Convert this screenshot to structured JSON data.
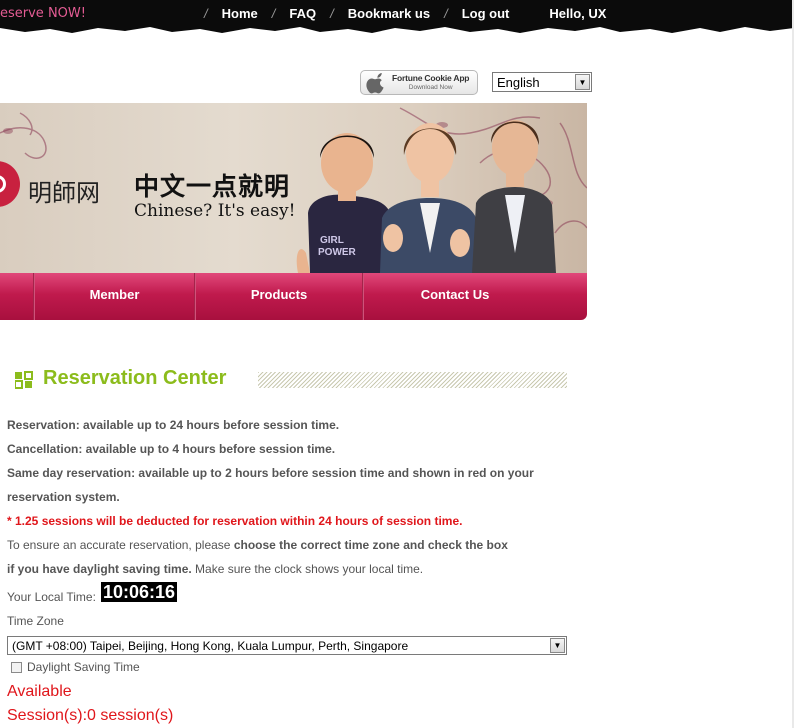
{
  "topbar": {
    "reserve_label": "eserve NOW!",
    "nav": [
      "Home",
      "FAQ",
      "Bookmark us",
      "Log out"
    ],
    "separator": "/",
    "greeting": "Hello, UX"
  },
  "app_badge": {
    "title": "Fortune Cookie App",
    "subtitle": "Download Now",
    "icon": "apple-icon"
  },
  "language": {
    "selected": "English"
  },
  "banner": {
    "logo_text": "明師网",
    "slogan_cn": "中文一点就明",
    "slogan_en": "Chinese? It's easy!",
    "shirt_text_1": "GIRL",
    "shirt_text_2": "POWER"
  },
  "main_nav": [
    "Member",
    "Products",
    "Contact Us"
  ],
  "reservation": {
    "title": "Reservation Center",
    "rule_1": "Reservation: available up to 24 hours before session time.",
    "rule_2": "Cancellation: available up to 4 hours before session time.",
    "rule_3a": "Same day reservation: available up to 2 hours before session time and shown in red on your",
    "rule_3b": "reservation system.",
    "warning": "* 1.25 sessions will be deducted for reservation within 24 hours of session time.",
    "tz_note_1a": "To ensure an accurate reservation, please ",
    "tz_note_1b": "choose the correct time zone and check the box",
    "tz_note_2a": "if you have daylight saving time.",
    "tz_note_2b": " Make sure the clock shows your local time.",
    "local_time_label": "Your Local Time:",
    "local_time": "10:06:16",
    "tz_label": "Time Zone",
    "tz_selected": "(GMT +08:00) Taipei, Beijing, Hong Kong, Kuala Lumpur, Perth, Singapore",
    "dst_label": "Daylight Saving Time",
    "dst_checked": false,
    "available_label": "Available",
    "sessions_label": "Session(s):0 session(s)"
  },
  "colors": {
    "accent_green": "#8cbc1c",
    "nav_pink": "#c01a4d",
    "warning_red": "#e0161b",
    "reserve_pink": "#e45c94"
  }
}
